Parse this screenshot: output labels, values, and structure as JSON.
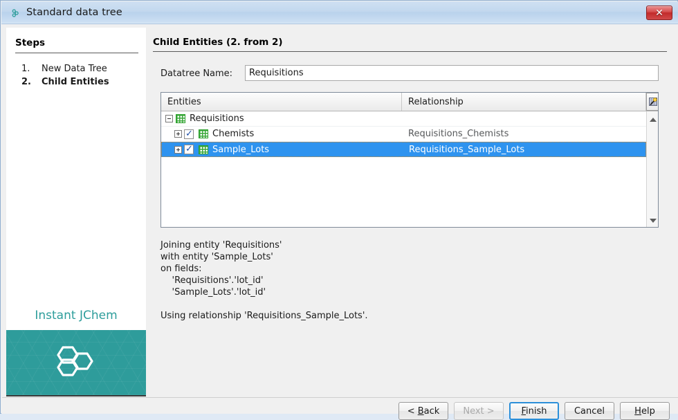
{
  "window": {
    "title": "Standard data tree",
    "icon": "jchem-molecule-icon",
    "close_label": "✕"
  },
  "steps_panel": {
    "title": "Steps",
    "items": [
      {
        "num": "1.",
        "label": "New Data Tree",
        "current": false
      },
      {
        "num": "2.",
        "label": "Child Entities",
        "current": true
      }
    ],
    "brand": {
      "text": "Instant JChem",
      "accent_color": "#2d9d9b",
      "panel_color": "#2e9c9b",
      "logo": "hexagon-trimer-logo"
    }
  },
  "main": {
    "heading": "Child Entities (2. from 2)",
    "name_field": {
      "label": "Datatree Name:",
      "value": "Requisitions",
      "placeholder": ""
    },
    "table": {
      "columns": [
        "Entities",
        "Relationship"
      ],
      "corner_button_icon": "column-selector-wand-icon",
      "rows": [
        {
          "indent": 0,
          "expander": "minus",
          "has_checkbox": false,
          "checked": false,
          "icon": "entity-grid-icon",
          "entity": "Requisitions",
          "relationship": "",
          "selected": false
        },
        {
          "indent": 1,
          "expander": "plus",
          "has_checkbox": true,
          "checked": true,
          "icon": "entity-grid-icon",
          "entity": "Chemists",
          "relationship": "Requisitions_Chemists",
          "selected": false
        },
        {
          "indent": 1,
          "expander": "plus",
          "has_checkbox": true,
          "checked": true,
          "icon": "entity-grid-icon",
          "entity": "Sample_Lots",
          "relationship": "Requisitions_Sample_Lots",
          "selected": true
        }
      ],
      "selection_color": "#2e93ef"
    },
    "description": "Joining entity 'Requisitions'\nwith entity 'Sample_Lots'\non fields:\n    'Requisitions'.'lot_id'\n    'Sample_Lots'.'lot_id'\n\nUsing relationship 'Requisitions_Sample_Lots'."
  },
  "footer": {
    "buttons": [
      {
        "name": "back",
        "prefix": "< ",
        "mnemonic": "B",
        "suffix": "ack",
        "state": "enabled"
      },
      {
        "name": "next",
        "prefix": "",
        "mnemonic": "N",
        "suffix": "ext >",
        "state": "disabled"
      },
      {
        "name": "finish",
        "prefix": "",
        "mnemonic": "F",
        "suffix": "inish",
        "state": "default"
      },
      {
        "name": "cancel",
        "prefix": "",
        "mnemonic": "C",
        "suffix": "ancel",
        "state": "enabled",
        "no_underline": true
      },
      {
        "name": "help",
        "prefix": "",
        "mnemonic": "H",
        "suffix": "elp",
        "state": "enabled"
      }
    ]
  }
}
